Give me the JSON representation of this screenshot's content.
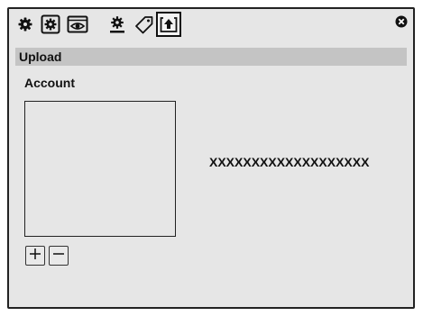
{
  "toolbar": {
    "icons": [
      "gear-icon",
      "settings-icon",
      "eye-icon",
      "user-settings-icon",
      "tag-icon",
      "upload-icon"
    ],
    "active": "upload-icon"
  },
  "section": {
    "title": "Upload"
  },
  "account": {
    "label": "Account",
    "value": "XXXXXXXXXXXXXXXXXXX"
  },
  "list_buttons": {
    "add": "+",
    "remove": "−"
  }
}
